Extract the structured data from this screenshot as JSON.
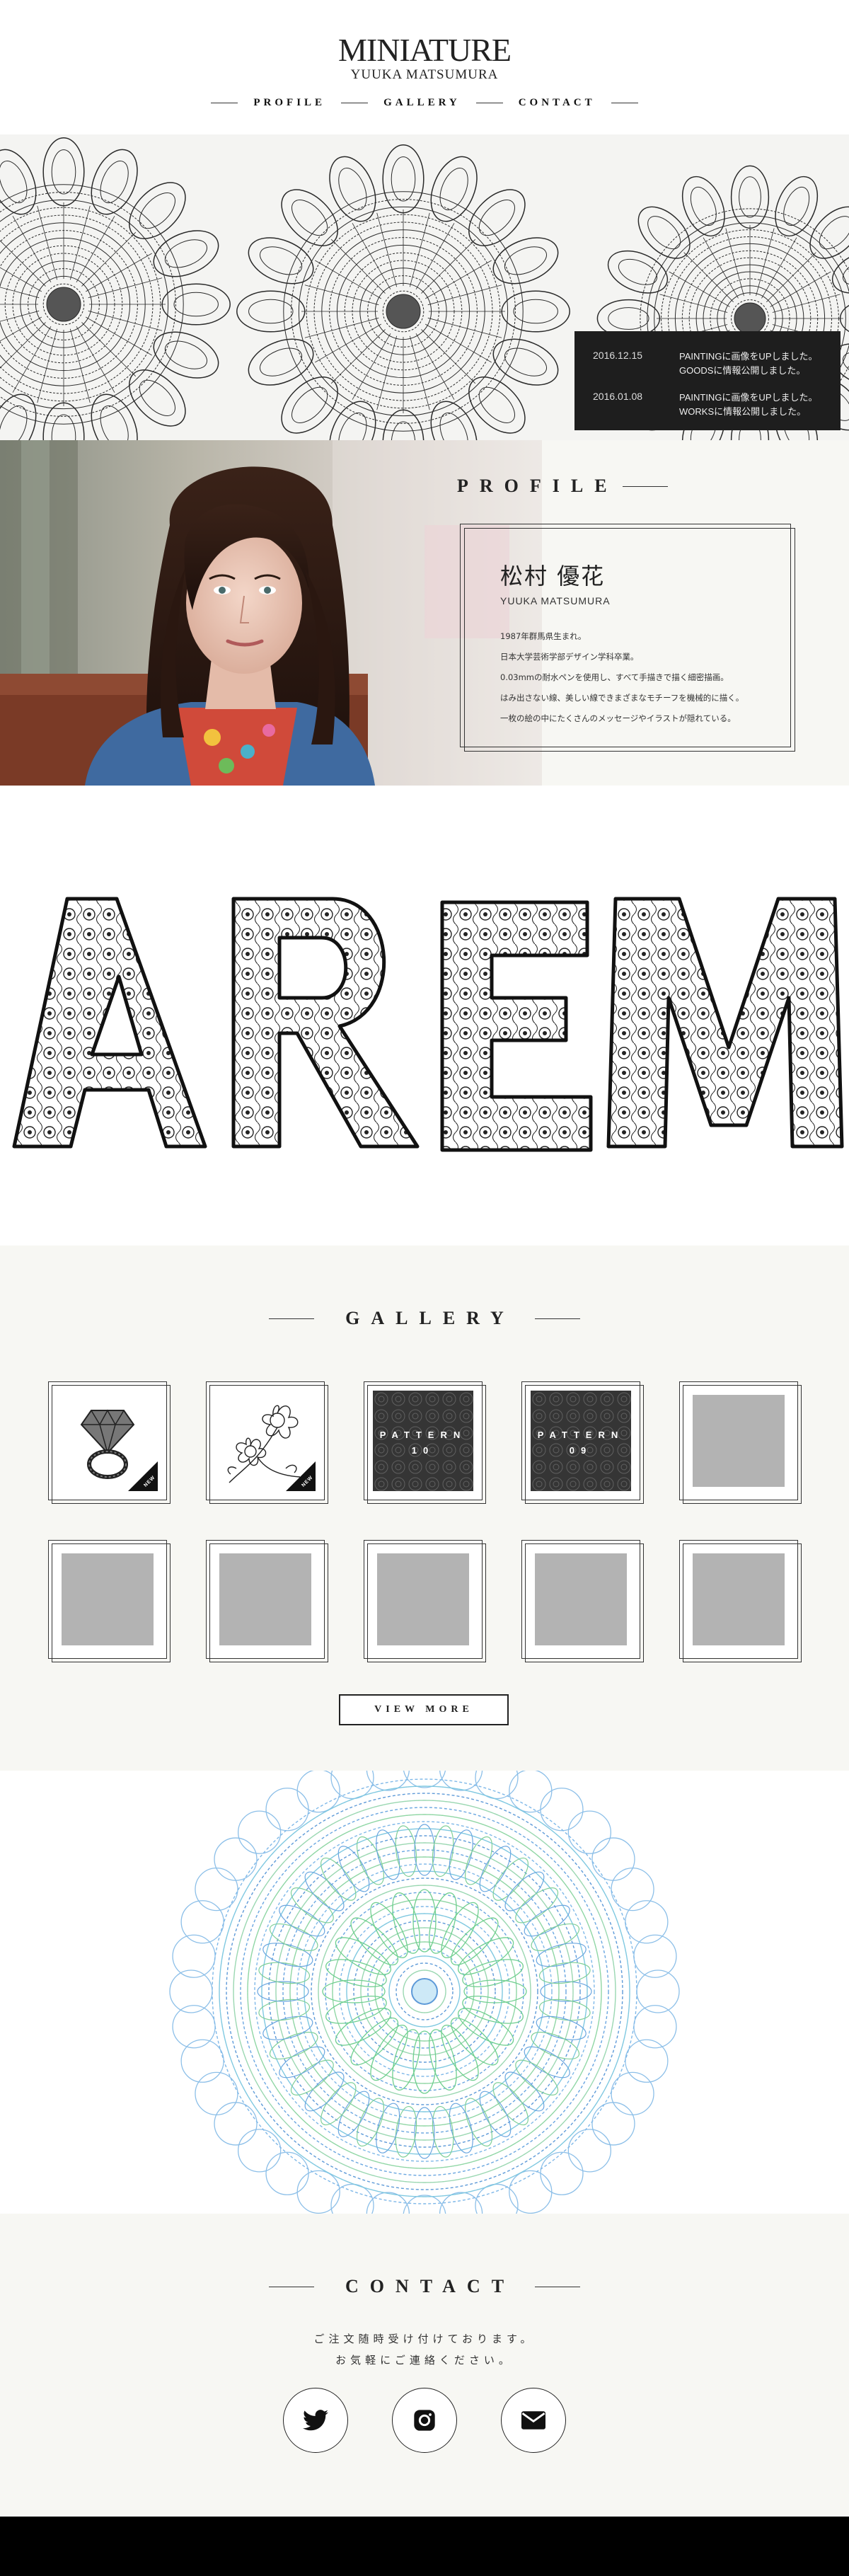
{
  "header": {
    "logo_main": "MINIATURE",
    "logo_sub": "YUUKA MATSUMURA",
    "nav": [
      "PROFILE",
      "GALLERY",
      "CONTACT"
    ]
  },
  "news": [
    {
      "date": "2016.12.15",
      "text": [
        "PAINTINGに画像をUPしました。",
        "GOODSに情報公開しました。"
      ]
    },
    {
      "date": "2016.01.08",
      "text": [
        "PAINTINGに画像をUPしました。",
        "WORKSに情報公開しました。"
      ]
    }
  ],
  "profile": {
    "heading": "PROFILE",
    "name": "松村 優花",
    "name_roman": "YUUKA MATSUMURA",
    "bio": [
      "1987年群馬県生まれ。",
      "日本大学芸術学部デザイン学科卒業。",
      "0.03mmの耐水ペンを使用し、すべて手描きで描く細密描画。",
      "はみ出さない線、美しい線できまざまなモチーフを機械的に描く。",
      "一枚の絵の中にたくさんのメッセージやイラストが隠れている。"
    ]
  },
  "letters": "AREM",
  "gallery": {
    "heading": "GALLERY",
    "items": [
      {
        "type": "diamond-ring",
        "badge": "NEW"
      },
      {
        "type": "flowers",
        "badge": "NEW"
      },
      {
        "type": "pattern",
        "label": "PATTERN",
        "number": "10"
      },
      {
        "type": "pattern",
        "label": "PATTERN",
        "number": "09"
      },
      {
        "type": "placeholder"
      },
      {
        "type": "placeholder"
      },
      {
        "type": "placeholder"
      },
      {
        "type": "placeholder"
      },
      {
        "type": "placeholder"
      },
      {
        "type": "placeholder"
      }
    ],
    "view_more": "VIEW MORE"
  },
  "contact": {
    "heading": "CONTACT",
    "message": [
      "ご注文随時受け付けております。",
      "お気軽にご連絡ください。"
    ],
    "social": [
      "twitter-icon",
      "instagram-icon",
      "mail-icon"
    ]
  },
  "colors": {
    "bg_light": "#f7f7f3",
    "news_bg": "#1e1e1e",
    "mandala_blue": "#6aa6e0",
    "mandala_green": "#6fcf8f",
    "placeholder_gray": "#b3b3b3"
  }
}
